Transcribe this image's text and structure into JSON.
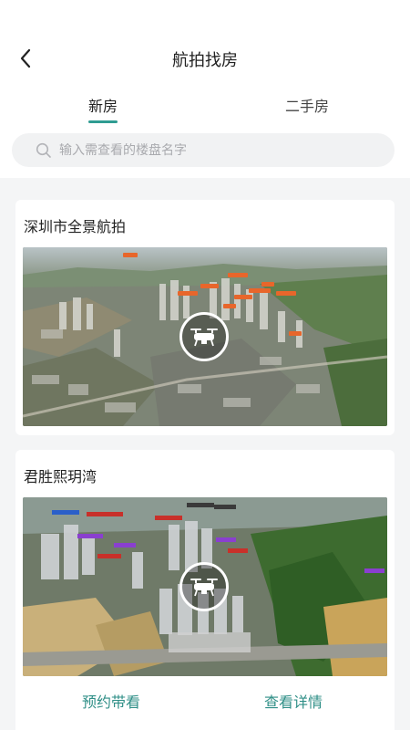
{
  "header": {
    "title": "航拍找房",
    "back_icon": "chevron-left-icon"
  },
  "tabs": [
    {
      "label": "新房",
      "active": true
    },
    {
      "label": "二手房",
      "active": false
    }
  ],
  "search": {
    "placeholder": "输入需查看的楼盘名字",
    "value": ""
  },
  "cards": [
    {
      "title": "深圳市全景航拍",
      "icon": "drone-icon"
    },
    {
      "title": "君胜熙玥湾",
      "icon": "drone-icon",
      "actions": {
        "reserve": "预约带看",
        "details": "查看详情"
      }
    }
  ],
  "colors": {
    "accent": "#2f9c92",
    "action_text": "#2f8f87",
    "background": "#f4f5f6"
  }
}
